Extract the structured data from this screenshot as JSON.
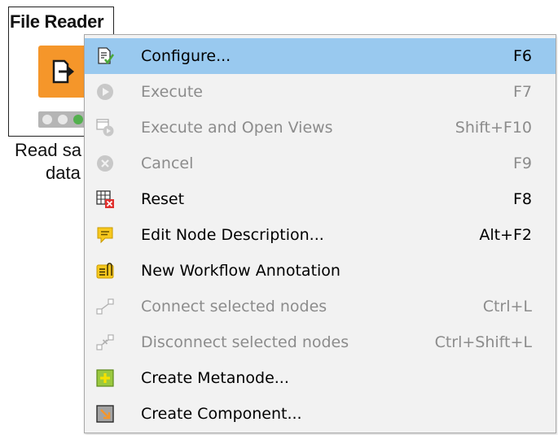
{
  "node": {
    "title": "File Reader",
    "description_line1": "Read sa",
    "description_line2": "data",
    "icon": "file-reader-icon",
    "status_lights": [
      "gray",
      "gray",
      "green"
    ]
  },
  "colors": {
    "node_orange": "#f5962a",
    "menu_bg": "#f2f2f2",
    "highlight": "#99c9ef",
    "disabled_text": "#8c8c8c",
    "status_green": "#53b04e"
  },
  "menu": {
    "items": [
      {
        "label": "Configure...",
        "shortcut": "F6",
        "enabled": true,
        "highlighted": true,
        "icon": "configure-icon"
      },
      {
        "label": "Execute",
        "shortcut": "F7",
        "enabled": false,
        "icon": "execute-icon"
      },
      {
        "label": "Execute and Open Views",
        "shortcut": "Shift+F10",
        "enabled": false,
        "icon": "execute-open-views-icon"
      },
      {
        "label": "Cancel",
        "shortcut": "F9",
        "enabled": false,
        "icon": "cancel-icon"
      },
      {
        "label": "Reset",
        "shortcut": "F8",
        "enabled": true,
        "icon": "reset-icon"
      },
      {
        "label": "Edit Node Description...",
        "shortcut": "Alt+F2",
        "enabled": true,
        "icon": "edit-description-icon"
      },
      {
        "label": "New Workflow Annotation",
        "shortcut": "",
        "enabled": true,
        "icon": "workflow-annotation-icon"
      },
      {
        "label": "Connect selected nodes",
        "shortcut": "Ctrl+L",
        "enabled": false,
        "icon": "connect-nodes-icon"
      },
      {
        "label": "Disconnect selected nodes",
        "shortcut": "Ctrl+Shift+L",
        "enabled": false,
        "icon": "disconnect-nodes-icon"
      },
      {
        "label": "Create Metanode...",
        "shortcut": "",
        "enabled": true,
        "icon": "create-metanode-icon"
      },
      {
        "label": "Create Component...",
        "shortcut": "",
        "enabled": true,
        "icon": "create-component-icon"
      }
    ]
  }
}
